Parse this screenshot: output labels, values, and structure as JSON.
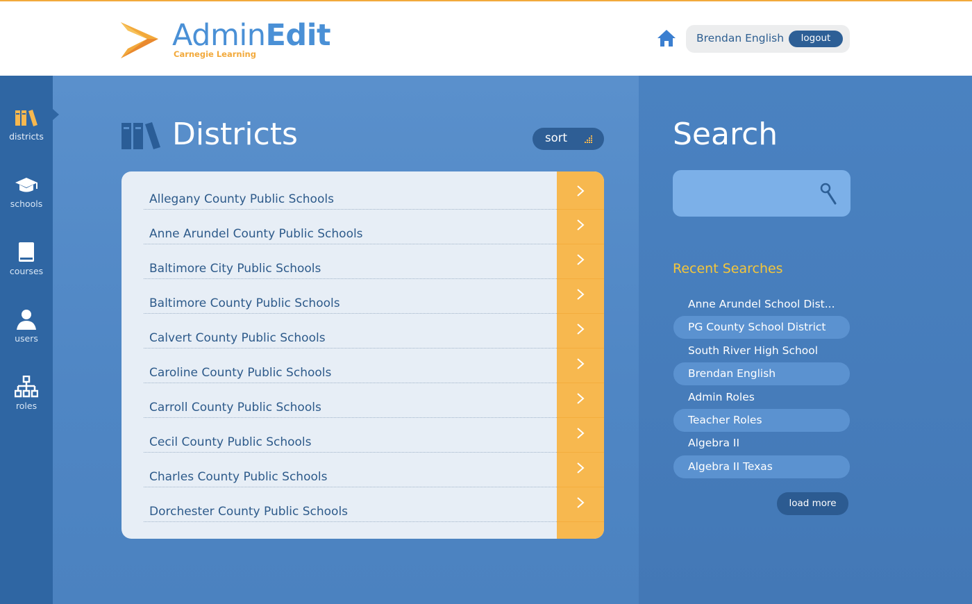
{
  "header": {
    "app_name_part1": "Admin",
    "app_name_part2": "Edit",
    "app_subtitle": "Carnegie Learning",
    "user_name": "Brendan English",
    "logout_label": "logout",
    "home_icon": "home-icon"
  },
  "sidebar": {
    "items": [
      {
        "label": "districts",
        "icon": "books-icon",
        "active": true
      },
      {
        "label": "schools",
        "icon": "graduation-cap-icon",
        "active": false
      },
      {
        "label": "courses",
        "icon": "book-icon",
        "active": false
      },
      {
        "label": "users",
        "icon": "user-icon",
        "active": false
      },
      {
        "label": "roles",
        "icon": "org-chart-icon",
        "active": false
      }
    ]
  },
  "districts": {
    "title": "Districts",
    "sort_label": "sort",
    "items": [
      "Allegany County Public Schools",
      "Anne Arundel County Public Schools",
      "Baltimore City Public Schools",
      "Baltimore County Public Schools",
      "Calvert County Public Schools",
      "Caroline County Public Schools",
      "Carroll County Public Schools",
      "Cecil County Public Schools",
      "Charles County Public Schools",
      "Dorchester County Public Schools"
    ]
  },
  "search": {
    "title": "Search",
    "input_value": "",
    "recent_title": "Recent Searches",
    "recent": [
      "Anne Arundel School Dist...",
      "PG County School District",
      "South River High School",
      "Brendan English",
      "Admin Roles",
      "Teacher Roles",
      "Algebra II",
      "Algebra II Texas"
    ],
    "load_more_label": "load more"
  },
  "colors": {
    "accent_orange": "#f7b84f",
    "brand_blue": "#4a90d6",
    "dark_blue": "#2e5e95",
    "recent_title_yellow": "#f5c63a"
  }
}
